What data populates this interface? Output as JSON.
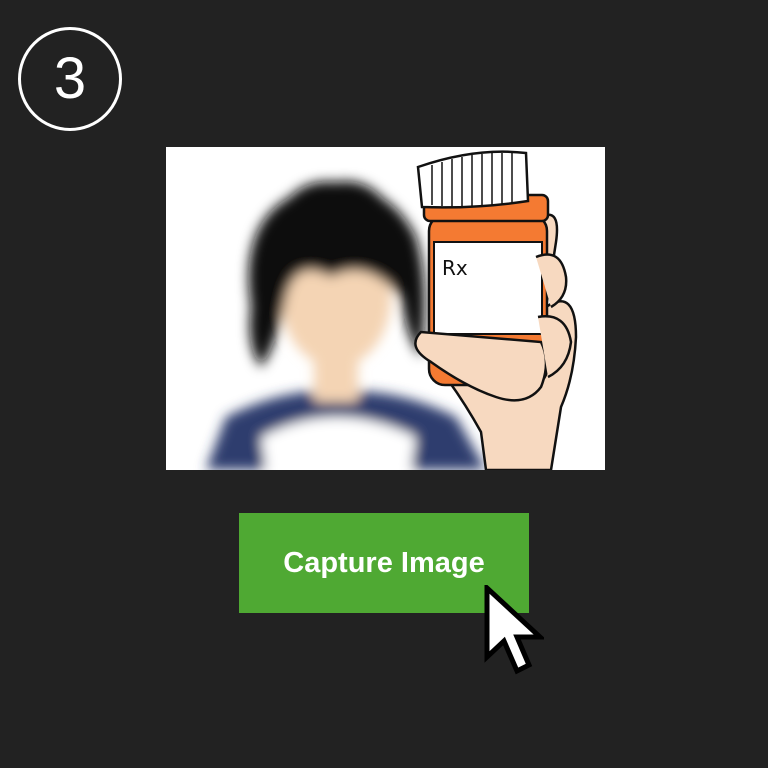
{
  "step": {
    "number": "3"
  },
  "preview": {
    "bottle_label_text": "Rx",
    "colors": {
      "bottle_orange": "#f47a32",
      "cap_white": "#ffffff",
      "hair": "#111111",
      "skin": "#f4d4b4",
      "shirt_navy": "#2e3d6e"
    }
  },
  "capture_button": {
    "label": "Capture Image",
    "color": "#4fa933"
  },
  "cursor": {
    "icon": "arrow-pointer-icon"
  }
}
